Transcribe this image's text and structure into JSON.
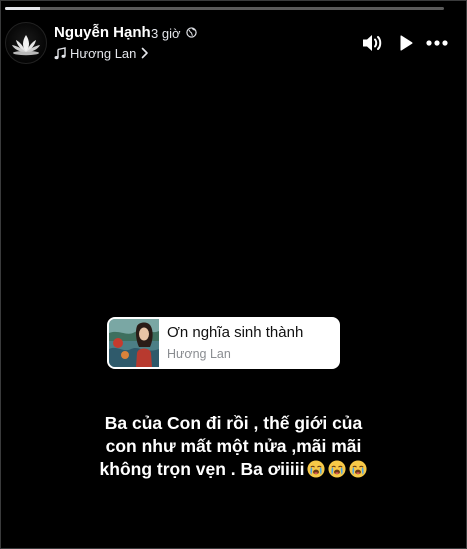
{
  "story": {
    "progress_fraction": 0.08,
    "user_name": "Nguyễn Hạnh",
    "time": "3 giờ",
    "music_label": "Hương Lan",
    "icons": {
      "privacy": "globe-icon",
      "music": "music-note-icon",
      "music_link": "chevron-right-icon",
      "volume": "volume-icon",
      "play": "play-icon",
      "more": "more-icon"
    }
  },
  "sticker": {
    "song_title": "Ơn nghĩa sinh thành",
    "artist": "Hương Lan"
  },
  "caption": {
    "line1": "Ba của Con đi rồi , thế giới của",
    "line2": "con như mất một nửa ,mãi mãi",
    "line3": "không trọn vẹn . Ba ơiiiii",
    "emoji": "crying-face-emoji",
    "emoji_count": 3
  },
  "colors": {
    "background": "#000000",
    "text": "#ffffff",
    "progress_track": "#5a5a5a",
    "progress_fill": "#e4e6eb",
    "sticker_bg": "#ffffff",
    "artist_text": "#8a8d91"
  }
}
